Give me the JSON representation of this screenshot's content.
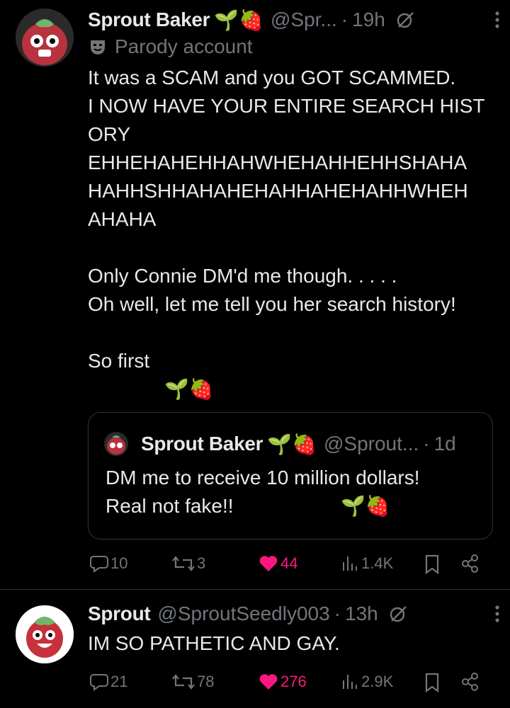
{
  "posts": [
    {
      "author_name": "Sprout Baker",
      "author_emoji": "🌱🍓",
      "handle": "@Spr...",
      "separator": "·",
      "time": "19h",
      "label": "Parody account",
      "body": "It was a SCAM and you GOT SCAMMED.\nI NOW HAVE YOUR ENTIRE SEARCH HISTORY\nEHHEHAHEHHAHWHEHAHHEHHSHAHA\nHAHHSHHAHAHEHAHHAHEHAHHWHEH\nAHAHA\n\nOnly Connie DM'd me though. . . . .\nOh well, let me tell you her search history!\n\nSo first",
      "body_emoji": "🌱🍓",
      "quote": {
        "author_name": "Sprout Baker",
        "author_emoji": "🌱🍓",
        "handle": "@Sprout...",
        "separator": "·",
        "time": "1d",
        "body": "DM me to receive 10 million dollars!\nReal not fake!!",
        "body_emoji": "🌱🍓"
      },
      "stats": {
        "replies": "10",
        "reposts": "3",
        "likes": "44",
        "views": "1.4K"
      }
    },
    {
      "author_name": "Sprout",
      "handle": "@SproutSeedly003",
      "separator": "·",
      "time": "13h",
      "body": "IM SO PATHETIC AND GAY.",
      "stats": {
        "replies": "21",
        "reposts": "78",
        "likes": "276",
        "views": "2.9K"
      }
    }
  ],
  "colors": {
    "background": "#000000",
    "text": "#e7e9ea",
    "muted": "#71767b",
    "like": "#f91880",
    "border": "#2f3336"
  },
  "icons": [
    "reply-icon",
    "repost-icon",
    "heart-icon",
    "views-icon",
    "bookmark-icon",
    "share-icon",
    "grok-icon",
    "more-icon",
    "parody-mask-icon"
  ]
}
